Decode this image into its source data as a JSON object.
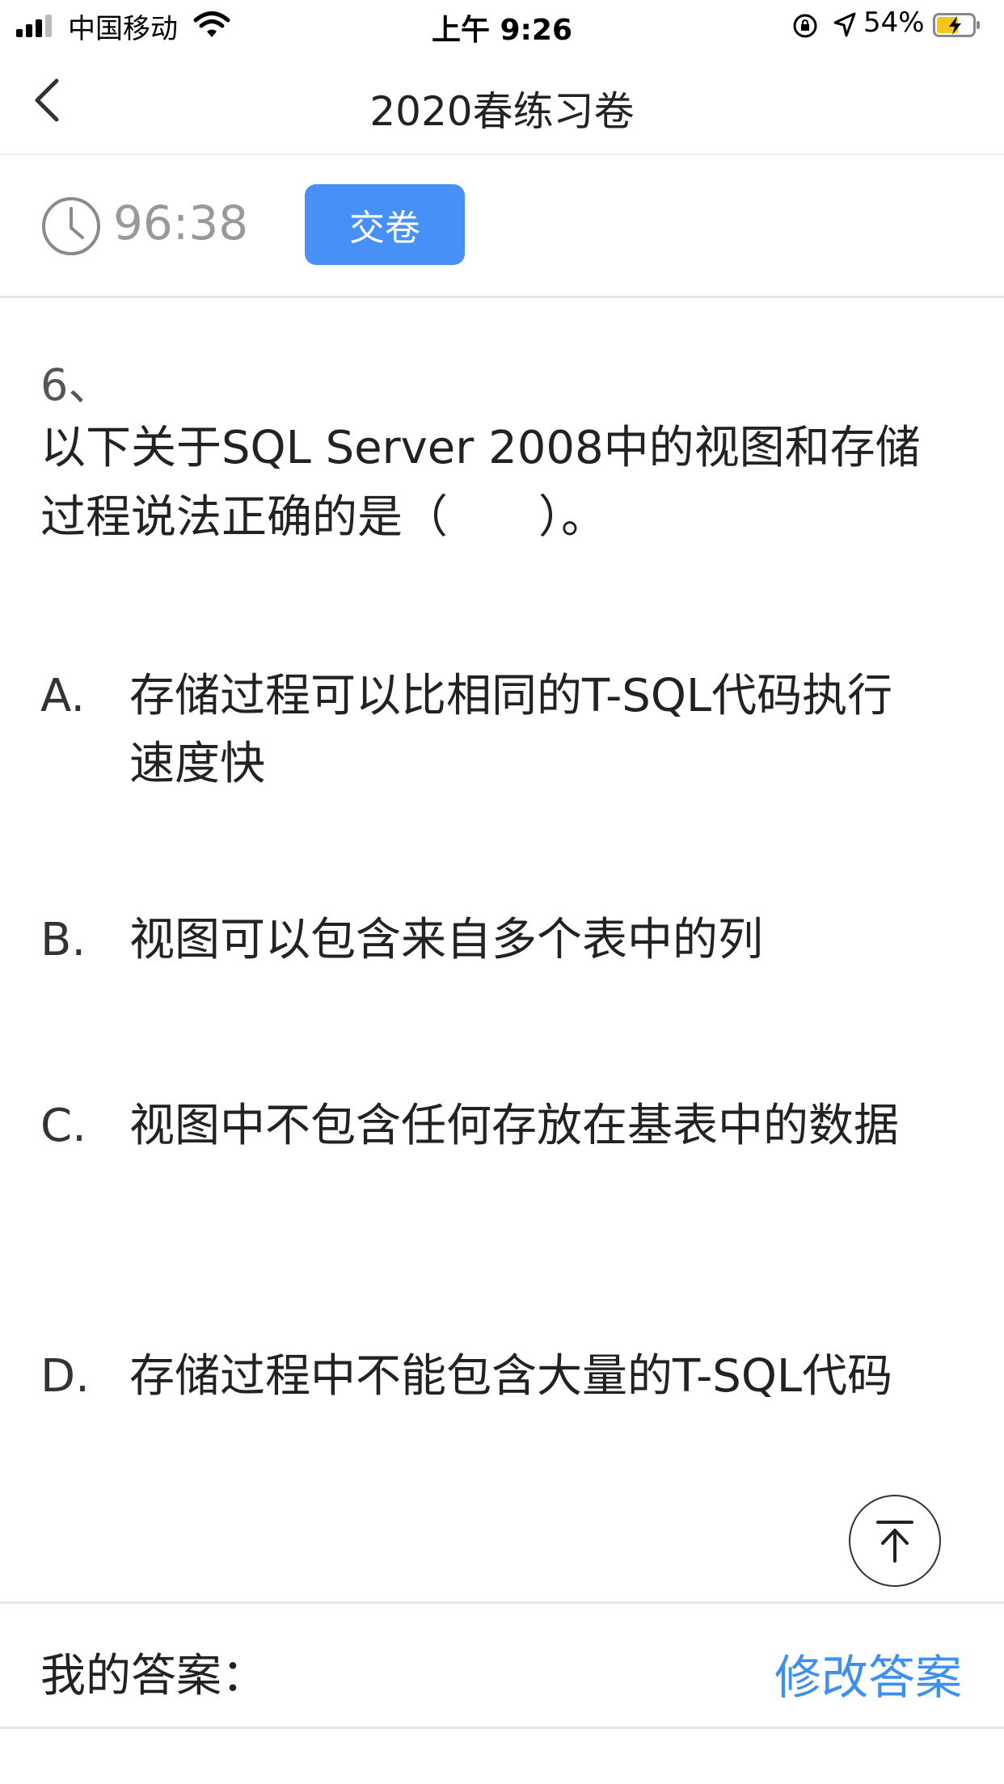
{
  "status_bar": {
    "carrier": "中国移动",
    "time": "上午 9:26",
    "battery": "54%"
  },
  "nav": {
    "title": "2020春练习卷"
  },
  "timer": {
    "remaining": "96:38",
    "submit_label": "交卷"
  },
  "question": {
    "number": "6、",
    "text": "以下关于SQL Server 2008中的视图和存储过程说法正确的是（　　）。",
    "options": [
      {
        "letter": "A.",
        "text": "存储过程可以比相同的T-SQL代码执行速度快"
      },
      {
        "letter": "B.",
        "text": "视图可以包含来自多个表中的列"
      },
      {
        "letter": "C.",
        "text": "视图中不包含任何存放在基表中的数据"
      },
      {
        "letter": "D.",
        "text": "存储过程中不能包含大量的T-SQL代码"
      }
    ]
  },
  "footer": {
    "my_answer_label": "我的答案：",
    "modify_label": "修改答案"
  },
  "colors": {
    "accent": "#4790f5",
    "link": "#3d8ff0",
    "battery_charge": "#f5c518"
  }
}
